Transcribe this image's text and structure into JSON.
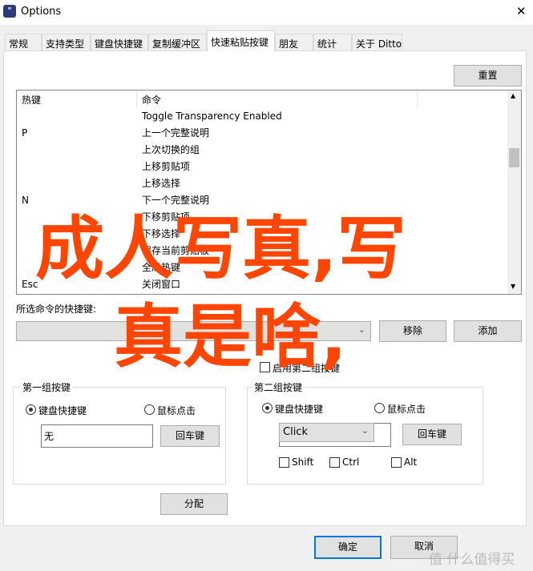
{
  "window": {
    "title": "Options",
    "close_icon": "close-icon"
  },
  "tabs": [
    "常规",
    "支持类型",
    "键盘快捷键",
    "复制缓冲区",
    "快速粘贴按键",
    "朋友",
    "统计",
    "关于 Ditto"
  ],
  "active_tab": 4,
  "reset_label": "重置",
  "list": {
    "columns": [
      "热键",
      "命令"
    ],
    "rows": [
      {
        "key": "",
        "cmd": "Toggle Transparency Enabled"
      },
      {
        "key": "P",
        "cmd": "上一个完整说明"
      },
      {
        "key": "",
        "cmd": "上次切换的组"
      },
      {
        "key": "",
        "cmd": "上移剪贴项"
      },
      {
        "key": "",
        "cmd": "上移选择"
      },
      {
        "key": "N",
        "cmd": "下一个完整说明"
      },
      {
        "key": "",
        "cmd": "下移剪贴项"
      },
      {
        "key": "",
        "cmd": "下移选择"
      },
      {
        "key": "",
        "cmd": "保存当前剪贴板"
      },
      {
        "key": "",
        "cmd": "全局热键"
      },
      {
        "key": "Esc",
        "cmd": "关闭窗口"
      }
    ]
  },
  "selected_label": "所选命令的快捷键:",
  "shortcut_value": "",
  "remove_label": "移除",
  "add_label": "添加",
  "enable_second": {
    "label": "启用第二组按键",
    "checked": false
  },
  "group1": {
    "title": "第一组按键",
    "keyboard": "键盘快捷键",
    "mouse": "鼠标点击",
    "selected": "keyboard",
    "value": "无",
    "enter": "回车键"
  },
  "group2": {
    "title": "第二组按键",
    "keyboard": "键盘快捷键",
    "mouse": "鼠标点击",
    "selected": "keyboard",
    "value": "Click",
    "enter": "回车键",
    "shift": "Shift",
    "ctrl": "Ctrl",
    "alt": "Alt"
  },
  "assign_label": "分配",
  "ok_label": "确定",
  "cancel_label": "取消",
  "overlay": {
    "line1": "成人写真,写",
    "line2": "真是啥,",
    "color": "#ff4500"
  },
  "watermark": "值 什么值得买"
}
